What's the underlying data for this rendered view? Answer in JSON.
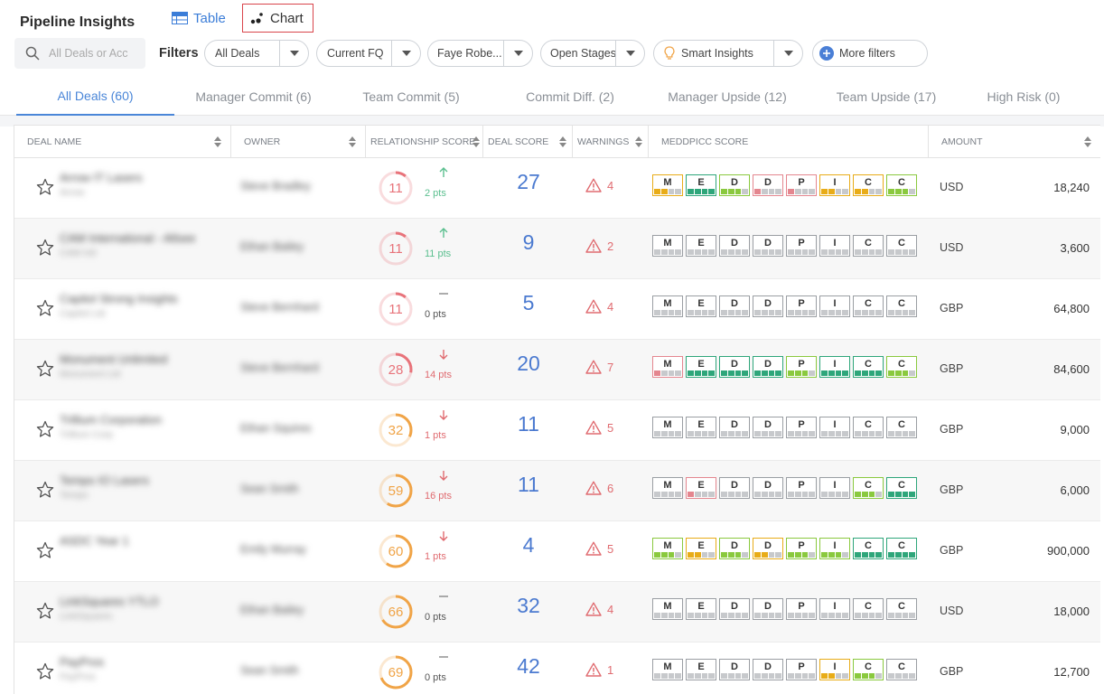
{
  "page": {
    "title": "Pipeline Insights"
  },
  "views": {
    "table_label": "Table",
    "chart_label": "Chart"
  },
  "search": {
    "placeholder": "All Deals or Acc"
  },
  "filters": {
    "label": "Filters",
    "deals": "All Deals",
    "period": "Current FQ",
    "owner": "Faye Robe...",
    "stages": "Open Stages",
    "insights": "Smart Insights",
    "more": "More filters"
  },
  "tabs": [
    {
      "label": "All Deals (60)"
    },
    {
      "label": "Manager Commit (6)"
    },
    {
      "label": "Team Commit (5)"
    },
    {
      "label": "Commit Diff. (2)"
    },
    {
      "label": "Manager Upside (12)"
    },
    {
      "label": "Team Upside (17)"
    },
    {
      "label": "High Risk (0)"
    }
  ],
  "columns": {
    "deal_name": "DEAL NAME",
    "owner": "OWNER",
    "relationship": "RELATIONSHIP SCORE",
    "deal_score": "DEAL SCORE",
    "warnings": "WARNINGS",
    "meddpicc": "MEDDPICC SCORE",
    "amount": "AMOUNT"
  },
  "colors": {
    "accent": "#4a86d8",
    "up": "#5bbf8f",
    "down": "#e06b70",
    "neutral": "#888888",
    "ring_red": "#e8737a",
    "ring_orange": "#f0a447",
    "medd_yellow": "#e8ac18",
    "medd_red": "#e4868f",
    "medd_green": "#8ac93e",
    "medd_teal": "#2ea67a"
  },
  "icons": {
    "search": "search-icon",
    "star": "star-icon",
    "warning": "warning-triangle-icon",
    "bulb": "lightbulb-icon",
    "plus": "plus-circle-icon",
    "sort": "sort-icon",
    "chevron": "chevron-down-icon"
  },
  "meddpicc_letters": [
    "M",
    "E",
    "D",
    "D",
    "P",
    "I",
    "C",
    "C"
  ],
  "rows": [
    {
      "name": "Arrow IT Lasers",
      "account": "Arrow",
      "owner": "Steve Bradley",
      "rel_score": 11,
      "trend": "up",
      "pts": "2 pts",
      "deal_score": 27,
      "warnings": 4,
      "currency": "USD",
      "amount": "18,240",
      "medd": [
        {
          "c": "y",
          "n": 2
        },
        {
          "c": "t",
          "n": 4
        },
        {
          "c": "g",
          "n": 3
        },
        {
          "c": "r",
          "n": 1
        },
        {
          "c": "r",
          "n": 1
        },
        {
          "c": "y",
          "n": 2
        },
        {
          "c": "y",
          "n": 2
        },
        {
          "c": "g",
          "n": 3
        }
      ]
    },
    {
      "name": "CAM International - Allsee",
      "account": "CAM Intl",
      "owner": "Ethan Bailey",
      "rel_score": 11,
      "trend": "up",
      "pts": "11 pts",
      "deal_score": 9,
      "warnings": 2,
      "currency": "USD",
      "amount": "3,600",
      "medd": [
        {
          "c": "n",
          "n": 0
        },
        {
          "c": "n",
          "n": 0
        },
        {
          "c": "n",
          "n": 0
        },
        {
          "c": "n",
          "n": 0
        },
        {
          "c": "n",
          "n": 0
        },
        {
          "c": "n",
          "n": 0
        },
        {
          "c": "n",
          "n": 0
        },
        {
          "c": "n",
          "n": 0
        }
      ]
    },
    {
      "name": "Capitol Strong Insights",
      "account": "Capitol Ltd",
      "owner": "Steve Bernhard",
      "rel_score": 11,
      "trend": "flat",
      "pts": "0 pts",
      "deal_score": 5,
      "warnings": 4,
      "currency": "GBP",
      "amount": "64,800",
      "medd": [
        {
          "c": "n",
          "n": 0
        },
        {
          "c": "n",
          "n": 0
        },
        {
          "c": "n",
          "n": 0
        },
        {
          "c": "n",
          "n": 0
        },
        {
          "c": "n",
          "n": 0
        },
        {
          "c": "n",
          "n": 0
        },
        {
          "c": "n",
          "n": 0
        },
        {
          "c": "n",
          "n": 0
        }
      ]
    },
    {
      "name": "Monument Unlimited",
      "account": "Monument Ltd",
      "owner": "Steve Bernhard",
      "rel_score": 28,
      "trend": "down",
      "pts": "14 pts",
      "deal_score": 20,
      "warnings": 7,
      "currency": "GBP",
      "amount": "84,600",
      "medd": [
        {
          "c": "r",
          "n": 1
        },
        {
          "c": "t",
          "n": 4
        },
        {
          "c": "t",
          "n": 4
        },
        {
          "c": "t",
          "n": 4
        },
        {
          "c": "g",
          "n": 3
        },
        {
          "c": "t",
          "n": 4
        },
        {
          "c": "t",
          "n": 4
        },
        {
          "c": "g",
          "n": 3
        }
      ]
    },
    {
      "name": "Trillium Corporation",
      "account": "Trillium Corp",
      "owner": "Ethan Squires",
      "rel_score": 32,
      "trend": "down",
      "pts": "1 pts",
      "deal_score": 11,
      "warnings": 5,
      "currency": "GBP",
      "amount": "9,000",
      "medd": [
        {
          "c": "n",
          "n": 0
        },
        {
          "c": "n",
          "n": 0
        },
        {
          "c": "n",
          "n": 0
        },
        {
          "c": "n",
          "n": 0
        },
        {
          "c": "n",
          "n": 0
        },
        {
          "c": "n",
          "n": 0
        },
        {
          "c": "n",
          "n": 0
        },
        {
          "c": "n",
          "n": 0
        }
      ]
    },
    {
      "name": "Tempo IO Lasers",
      "account": "Tempo",
      "owner": "Sean Smith",
      "rel_score": 59,
      "trend": "down",
      "pts": "16 pts",
      "deal_score": 11,
      "warnings": 6,
      "currency": "GBP",
      "amount": "6,000",
      "medd": [
        {
          "c": "n",
          "n": 0
        },
        {
          "c": "r",
          "n": 1
        },
        {
          "c": "n",
          "n": 0
        },
        {
          "c": "n",
          "n": 0
        },
        {
          "c": "n",
          "n": 0
        },
        {
          "c": "n",
          "n": 0
        },
        {
          "c": "g",
          "n": 3
        },
        {
          "c": "t",
          "n": 4
        }
      ]
    },
    {
      "name": "ASDC Year 1",
      "account": "",
      "owner": "Emily Murray",
      "rel_score": 60,
      "trend": "down",
      "pts": "1 pts",
      "deal_score": 4,
      "warnings": 5,
      "currency": "GBP",
      "amount": "900,000",
      "medd": [
        {
          "c": "g",
          "n": 3
        },
        {
          "c": "y",
          "n": 2
        },
        {
          "c": "g",
          "n": 3
        },
        {
          "c": "y",
          "n": 2
        },
        {
          "c": "g",
          "n": 3
        },
        {
          "c": "g",
          "n": 3
        },
        {
          "c": "t",
          "n": 4
        },
        {
          "c": "t",
          "n": 4
        }
      ]
    },
    {
      "name": "LinkSquares YTLO",
      "account": "LinkSquares",
      "owner": "Ethan Bailey",
      "rel_score": 66,
      "trend": "flat",
      "pts": "0 pts",
      "deal_score": 32,
      "warnings": 4,
      "currency": "USD",
      "amount": "18,000",
      "medd": [
        {
          "c": "n",
          "n": 0
        },
        {
          "c": "n",
          "n": 0
        },
        {
          "c": "n",
          "n": 0
        },
        {
          "c": "n",
          "n": 0
        },
        {
          "c": "n",
          "n": 0
        },
        {
          "c": "n",
          "n": 0
        },
        {
          "c": "n",
          "n": 0
        },
        {
          "c": "n",
          "n": 0
        }
      ]
    },
    {
      "name": "PayPros",
      "account": "PayPros",
      "owner": "Sean Smith",
      "rel_score": 69,
      "trend": "flat",
      "pts": "0 pts",
      "deal_score": 42,
      "warnings": 1,
      "currency": "GBP",
      "amount": "12,700",
      "medd": [
        {
          "c": "n",
          "n": 0
        },
        {
          "c": "n",
          "n": 0
        },
        {
          "c": "n",
          "n": 0
        },
        {
          "c": "n",
          "n": 0
        },
        {
          "c": "n",
          "n": 0
        },
        {
          "c": "y",
          "n": 2
        },
        {
          "c": "g",
          "n": 3
        },
        {
          "c": "n",
          "n": 0
        }
      ]
    }
  ]
}
